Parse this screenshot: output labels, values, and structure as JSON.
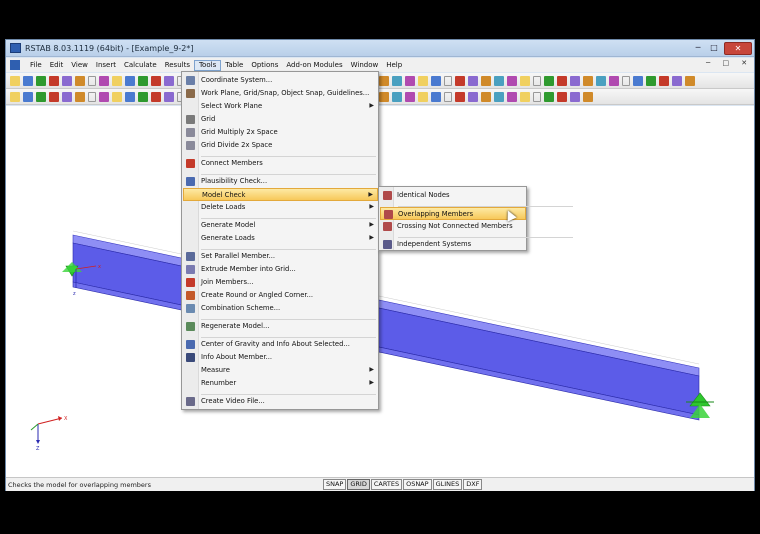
{
  "window": {
    "title": "RSTAB 8.03.1119 (64bit) - [Example_9-2*]",
    "controls": [
      "─",
      "□",
      "✕"
    ]
  },
  "menubar": {
    "items": [
      "File",
      "Edit",
      "View",
      "Insert",
      "Calculate",
      "Results",
      "Tools",
      "Table",
      "Options",
      "Add-on Modules",
      "Window",
      "Help"
    ],
    "active": "Tools"
  },
  "tools_menu": {
    "items": [
      {
        "label": "Coordinate System...",
        "icon": "coordinate-system-icon",
        "color": "#6a7fa8"
      },
      {
        "label": "Work Plane, Grid/Snap, Object Snap, Guidelines...",
        "icon": "work-plane-icon",
        "color": "#8a6a4a"
      },
      {
        "label": "Select Work Plane",
        "submenu": true
      },
      {
        "label": "Grid",
        "icon": "grid-icon",
        "color": "#7a7a7a"
      },
      {
        "label": "Grid Multiply 2x Space",
        "icon": "grid-multiply-icon",
        "color": "#8a8a9a"
      },
      {
        "label": "Grid Divide 2x Space",
        "icon": "grid-divide-icon",
        "color": "#8a8a9a"
      },
      {
        "label": "Connect Members",
        "icon": "connect-members-icon",
        "color": "#c43a2a"
      },
      {
        "label": "Plausibility Check...",
        "icon": "plausibility-check-icon",
        "color": "#4a6ab0"
      },
      {
        "label": "Model Check",
        "submenu": true,
        "highlighted": true
      },
      {
        "label": "Delete Loads",
        "submenu": true
      },
      {
        "label": "Generate Model",
        "submenu": true
      },
      {
        "label": "Generate Loads",
        "submenu": true
      },
      {
        "label": "Set Parallel Member...",
        "icon": "parallel-member-icon",
        "color": "#5a6a9a"
      },
      {
        "label": "Extrude Member into Grid...",
        "icon": "extrude-member-icon",
        "color": "#7a7ab0"
      },
      {
        "label": "Join Members...",
        "icon": "join-members-icon",
        "color": "#c43a2a"
      },
      {
        "label": "Create Round or Angled Corner...",
        "icon": "corner-icon",
        "color": "#c45a2a"
      },
      {
        "label": "Combination Scheme...",
        "icon": "combination-scheme-icon",
        "color": "#6a8ab0"
      },
      {
        "label": "Regenerate Model...",
        "icon": "regenerate-model-icon",
        "color": "#5a8a5a"
      },
      {
        "label": "Center of Gravity and Info About Selected...",
        "icon": "center-of-gravity-icon",
        "color": "#4a6ab0"
      },
      {
        "label": "Info About Member...",
        "icon": "info-member-icon",
        "color": "#3a4a7a"
      },
      {
        "label": "Measure",
        "submenu": true
      },
      {
        "label": "Renumber",
        "submenu": true
      },
      {
        "label": "Create Video File...",
        "icon": "video-file-icon",
        "color": "#6a6a8a"
      }
    ]
  },
  "model_check_submenu": {
    "items": [
      {
        "label": "Identical Nodes",
        "icon": "identical-nodes-icon",
        "color": "#b04a4a"
      },
      {
        "label": "Overlapping Members",
        "icon": "overlapping-members-icon",
        "color": "#b04a4a",
        "highlighted": true
      },
      {
        "label": "Crossing Not Connected Members",
        "icon": "crossing-members-icon",
        "color": "#b04a4a"
      },
      {
        "label": "Independent Systems",
        "icon": "independent-systems-icon",
        "color": "#5a5a8a"
      }
    ]
  },
  "status": {
    "text": "Checks the model for overlapping members",
    "toggles": [
      "SNAP",
      "GRID",
      "CARTES",
      "OSNAP",
      "GLINES",
      "DXF"
    ],
    "active_toggle": "GRID"
  },
  "canvas": {
    "axis_labels": {
      "x": "X",
      "z": "Z"
    }
  },
  "colors": {
    "beam_top": "#8e8ef5",
    "beam_side": "#5c5ce8",
    "support": "#2ec62e",
    "menu_highlight": "#f7c85a"
  }
}
